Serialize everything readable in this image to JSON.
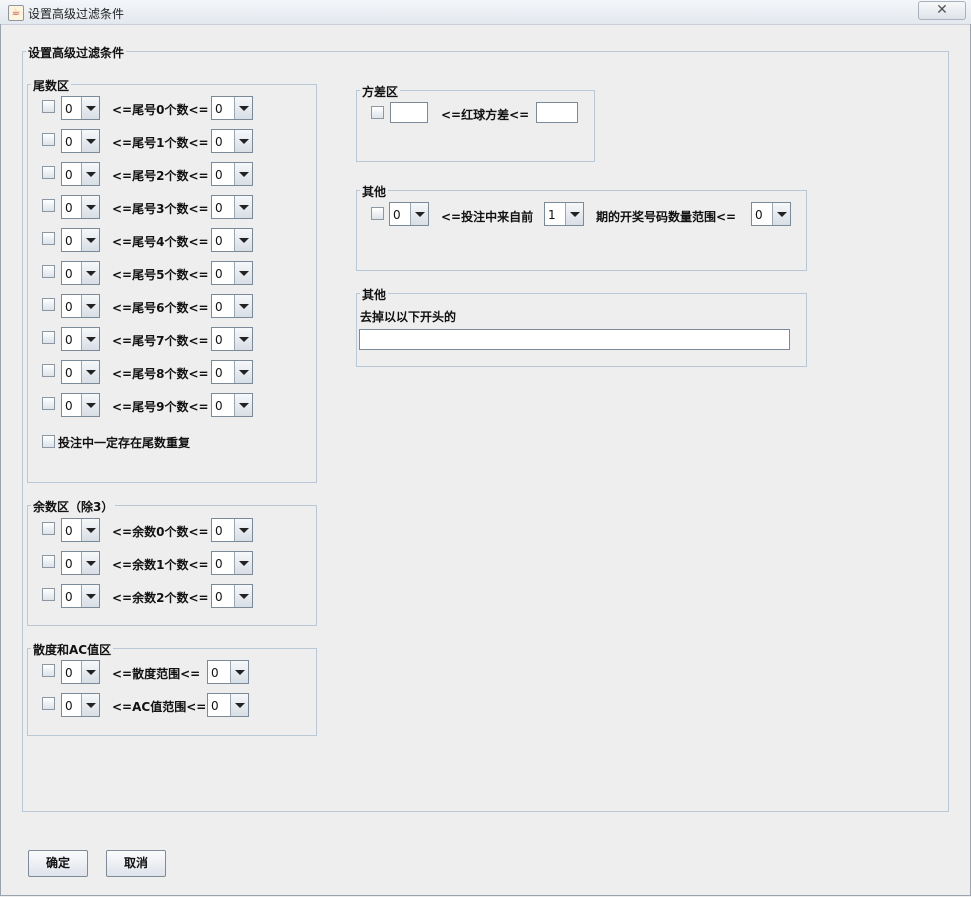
{
  "window": {
    "title": "设置高级过滤条件",
    "close_glyph": "✕",
    "icon": "java-icon"
  },
  "main_group": {
    "legend": "设置高级过滤条件"
  },
  "tail_group": {
    "legend": "尾数区",
    "rows": [
      {
        "from": "0",
        "label": "<=尾号0个数<=",
        "to": "0"
      },
      {
        "from": "0",
        "label": "<=尾号1个数<=",
        "to": "0"
      },
      {
        "from": "0",
        "label": "<=尾号2个数<=",
        "to": "0"
      },
      {
        "from": "0",
        "label": "<=尾号3个数<=",
        "to": "0"
      },
      {
        "from": "0",
        "label": "<=尾号4个数<=",
        "to": "0"
      },
      {
        "from": "0",
        "label": "<=尾号5个数<=",
        "to": "0"
      },
      {
        "from": "0",
        "label": "<=尾号6个数<=",
        "to": "0"
      },
      {
        "from": "0",
        "label": "<=尾号7个数<=",
        "to": "0"
      },
      {
        "from": "0",
        "label": "<=尾号8个数<=",
        "to": "0"
      },
      {
        "from": "0",
        "label": "<=尾号9个数<=",
        "to": "0"
      }
    ],
    "repeat_label": "投注中一定存在尾数重复"
  },
  "mod_group": {
    "legend": "余数区（除3）",
    "rows": [
      {
        "from": "0",
        "label": "<=余数0个数<=",
        "to": "0"
      },
      {
        "from": "0",
        "label": "<=余数1个数<=",
        "to": "0"
      },
      {
        "from": "0",
        "label": "<=余数2个数<=",
        "to": "0"
      }
    ]
  },
  "spread_group": {
    "legend": "散度和AC值区",
    "rows": [
      {
        "from": "0",
        "label": "<=散度范围<=",
        "to": "0"
      },
      {
        "from": "0",
        "label": "<=AC值范围<=",
        "to": "0"
      }
    ]
  },
  "variance_group": {
    "legend": "方差区",
    "label": "<=红球方差<=",
    "min_value": "",
    "max_value": ""
  },
  "other_group_1": {
    "legend": "其他",
    "from": "0",
    "label1": "<=投注中来自前",
    "periods": "1",
    "label2": "期的开奖号码数量范围<=",
    "to": "0"
  },
  "other_group_2": {
    "legend": "其他",
    "label": "去掉以以下开头的",
    "prefix_value": ""
  },
  "buttons": {
    "ok": "确定",
    "cancel": "取消"
  }
}
